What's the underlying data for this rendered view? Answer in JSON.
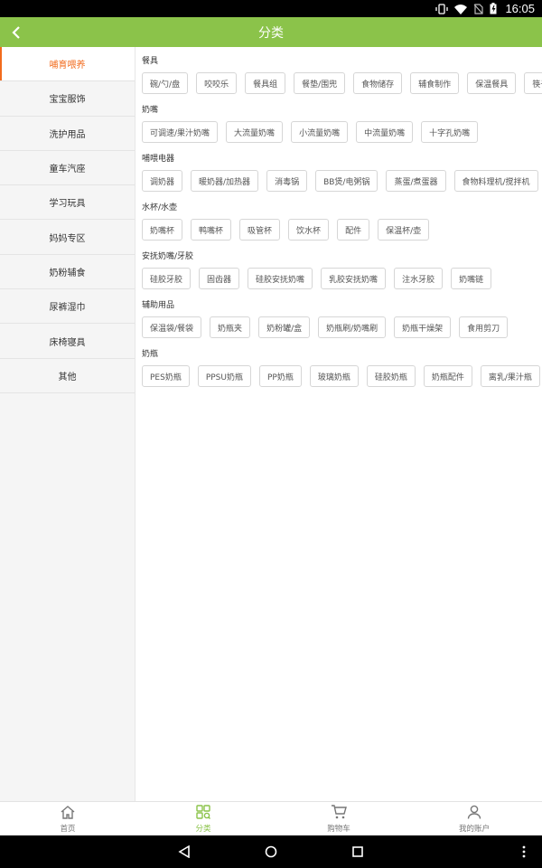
{
  "status_bar": {
    "time": "16:05"
  },
  "header": {
    "title": "分类"
  },
  "sidebar": {
    "items": [
      {
        "label": "哺育喂养",
        "active": true
      },
      {
        "label": "宝宝服饰",
        "active": false
      },
      {
        "label": "洗护用品",
        "active": false
      },
      {
        "label": "童车汽座",
        "active": false
      },
      {
        "label": "学习玩具",
        "active": false
      },
      {
        "label": "妈妈专区",
        "active": false
      },
      {
        "label": "奶粉辅食",
        "active": false
      },
      {
        "label": "尿裤湿巾",
        "active": false
      },
      {
        "label": "床椅寝具",
        "active": false
      },
      {
        "label": "其他",
        "active": false
      }
    ]
  },
  "groups": [
    {
      "title": "餐具",
      "items": [
        "碗/勺/盘",
        "咬咬乐",
        "餐具组",
        "餐垫/围兜",
        "食物储存",
        "辅食制作",
        "保温餐具",
        "筷子"
      ]
    },
    {
      "title": "奶嘴",
      "items": [
        "可调速/果汁奶嘴",
        "大流量奶嘴",
        "小流量奶嘴",
        "中流量奶嘴",
        "十字孔奶嘴"
      ]
    },
    {
      "title": "哺喂电器",
      "items": [
        "调奶器",
        "暖奶器/加热器",
        "消毒锅",
        "BB煲/电粥锅",
        "蒸蛋/煮蛋器",
        "食物料理机/搅拌机"
      ]
    },
    {
      "title": "水杯/水壶",
      "items": [
        "奶嘴杯",
        "鸭嘴杯",
        "吸管杯",
        "饮水杯",
        "配件",
        "保温杯/壶"
      ]
    },
    {
      "title": "安抚奶嘴/牙胶",
      "items": [
        "硅胶牙胶",
        "固齿器",
        "硅胶安抚奶嘴",
        "乳胶安抚奶嘴",
        "注水牙胶",
        "奶嘴链"
      ]
    },
    {
      "title": "辅助用品",
      "items": [
        "保温袋/餐袋",
        "奶瓶夹",
        "奶粉罐/盒",
        "奶瓶刷/奶嘴刷",
        "奶瓶干燥架",
        "食用剪刀"
      ]
    },
    {
      "title": "奶瓶",
      "items": [
        "PES奶瓶",
        "PPSU奶瓶",
        "PP奶瓶",
        "玻璃奶瓶",
        "硅胶奶瓶",
        "奶瓶配件",
        "离乳/果汁瓶"
      ]
    }
  ],
  "bottom_nav": [
    {
      "label": "首页",
      "icon": "home-icon",
      "active": false
    },
    {
      "label": "分类",
      "icon": "category-icon",
      "active": true
    },
    {
      "label": "购物车",
      "icon": "cart-icon",
      "active": false
    },
    {
      "label": "我的账户",
      "icon": "account-icon",
      "active": false
    }
  ],
  "colors": {
    "accent": "#8bc34a",
    "active_text": "#f26b1d"
  }
}
